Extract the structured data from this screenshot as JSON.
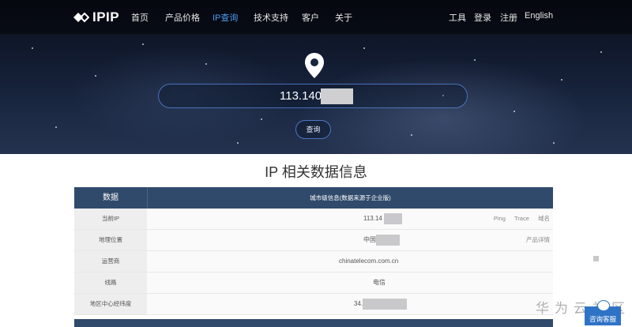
{
  "nav": {
    "logo_text": "IPIP",
    "items": [
      {
        "label": "首页",
        "active": false
      },
      {
        "label": "产品价格",
        "active": false
      },
      {
        "label": "IP查询",
        "active": true
      },
      {
        "label": "技术支持",
        "active": false
      },
      {
        "label": "客户",
        "active": false
      },
      {
        "label": "关于",
        "active": false
      }
    ],
    "right_items": [
      {
        "label": "工具"
      },
      {
        "label": "登录"
      },
      {
        "label": "注册"
      },
      {
        "label": "English"
      }
    ]
  },
  "search": {
    "value": "113.140",
    "button_label": "查询"
  },
  "section_title": "IP 相关数据信息",
  "table": {
    "header_label": "数据",
    "header_value": "城市级信息(数据来源于企业版)",
    "rows": [
      {
        "label": "当前IP",
        "value": "113.14",
        "links": [
          "Ping",
          "Trace",
          "域名"
        ]
      },
      {
        "label": "地理位置",
        "value": "中国",
        "links": [
          "产品详情"
        ]
      },
      {
        "label": "运营商",
        "value": "chinatelecom.com.cn",
        "links": []
      },
      {
        "label": "线路",
        "value": "电信",
        "links": []
      },
      {
        "label": "地区中心经纬度",
        "value": "34.",
        "links": []
      }
    ]
  },
  "watermark": "华为云社区",
  "service_label": "咨询客服",
  "colors": {
    "accent": "#4a9af0",
    "table_header": "#2f4a6b",
    "service": "#2f73c7"
  }
}
